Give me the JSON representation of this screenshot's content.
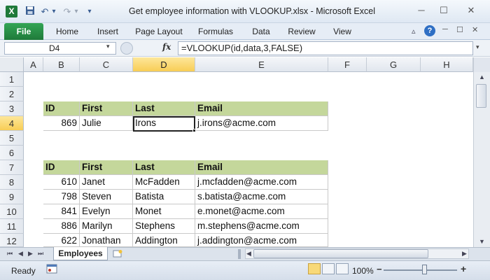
{
  "window": {
    "title": "Get employee information with VLOOKUP.xlsx - Microsoft Excel",
    "app_icon": "X",
    "qa_icons": [
      "save-icon",
      "undo-icon",
      "redo-icon"
    ],
    "undo_glyph": "↶",
    "redo_glyph": "↷",
    "dropdown_glyph": "▾",
    "minimize_glyph": "─",
    "maximize_glyph": "☐",
    "close_glyph": "✕",
    "help_glyph": "?"
  },
  "ribbon": {
    "file_label": "File",
    "tabs": [
      "Home",
      "Insert",
      "Page Layout",
      "Formulas",
      "Data",
      "Review",
      "View"
    ]
  },
  "formula_bar": {
    "name_box": "D4",
    "fx": "fx",
    "formula": "=VLOOKUP(id,data,3,FALSE)"
  },
  "grid": {
    "columns": [
      "A",
      "B",
      "C",
      "D",
      "E",
      "F",
      "G",
      "H"
    ],
    "rows": [
      "1",
      "2",
      "3",
      "4",
      "5",
      "6",
      "7",
      "8",
      "9",
      "10",
      "11",
      "12"
    ],
    "selected_column": "D",
    "selected_row": "4"
  },
  "lookup": {
    "headers": [
      "ID",
      "First",
      "Last",
      "Email"
    ],
    "row": [
      "869",
      "Julie",
      "Irons",
      "j.irons@acme.com"
    ]
  },
  "data_table": {
    "headers": [
      "ID",
      "First",
      "Last",
      "Email"
    ],
    "rows": [
      [
        "610",
        "Janet",
        "McFadden",
        "j.mcfadden@acme.com"
      ],
      [
        "798",
        "Steven",
        "Batista",
        "s.batista@acme.com"
      ],
      [
        "841",
        "Evelyn",
        "Monet",
        "e.monet@acme.com"
      ],
      [
        "886",
        "Marilyn",
        "Stephens",
        "m.stephens@acme.com"
      ],
      [
        "622",
        "Jonathan",
        "Addington",
        "j.addington@acme.com"
      ]
    ]
  },
  "sheets": {
    "active": "Employees",
    "nav_glyphs": [
      "⏮",
      "◀",
      "▶",
      "⏭"
    ]
  },
  "status": {
    "ready": "Ready",
    "zoom": "100%",
    "zoom_minus": "−",
    "zoom_plus": "+"
  },
  "colors": {
    "header_fill": "#c4d79b",
    "file_tab": "#1f7a3a",
    "selection_header": "#f8cd55"
  }
}
